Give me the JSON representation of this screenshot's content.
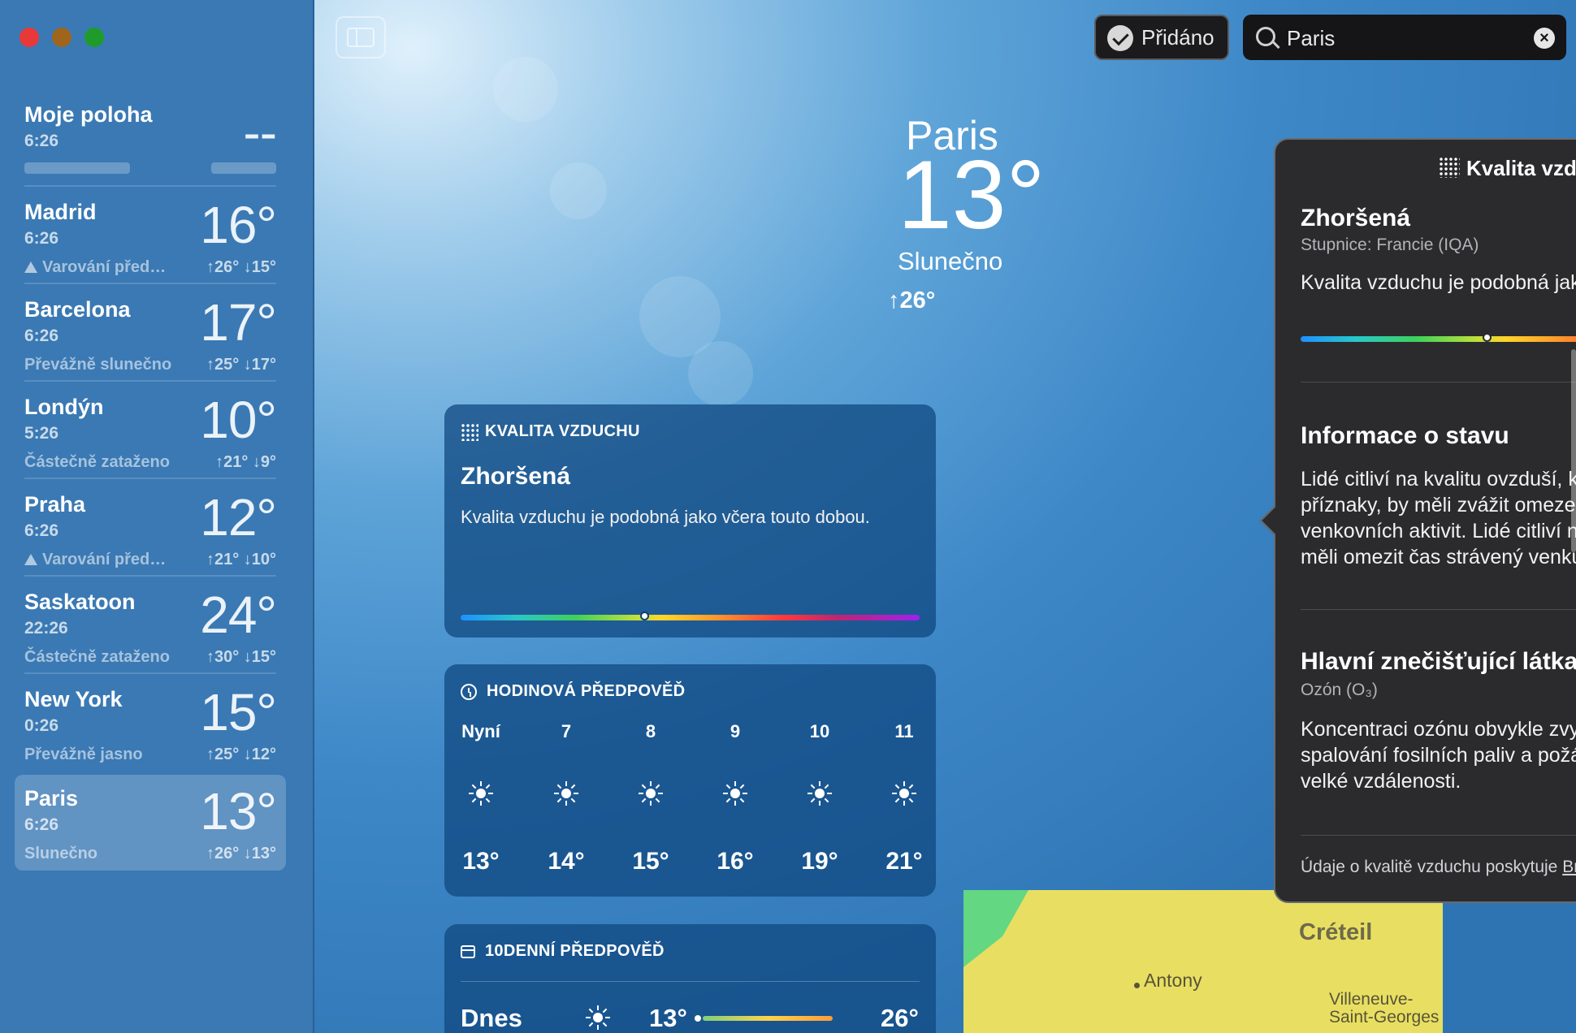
{
  "sidebar": {
    "locations": [
      {
        "name": "Moje poloha",
        "time": "6:26",
        "temp": "--",
        "condition": "",
        "hilo": "",
        "warning": false,
        "selected": false
      },
      {
        "name": "Madrid",
        "time": "6:26",
        "temp": "16°",
        "condition": "Varování před…",
        "hilo": "↑26° ↓15°",
        "warning": true,
        "selected": false
      },
      {
        "name": "Barcelona",
        "time": "6:26",
        "temp": "17°",
        "condition": "Převážně slunečno",
        "hilo": "↑25° ↓17°",
        "warning": false,
        "selected": false
      },
      {
        "name": "Londýn",
        "time": "5:26",
        "temp": "10°",
        "condition": "Částečně zataženo",
        "hilo": "↑21° ↓9°",
        "warning": false,
        "selected": false
      },
      {
        "name": "Praha",
        "time": "6:26",
        "temp": "12°",
        "condition": "Varování před…",
        "hilo": "↑21° ↓10°",
        "warning": true,
        "selected": false
      },
      {
        "name": "Saskatoon",
        "time": "22:26",
        "temp": "24°",
        "condition": "Částečně zataženo",
        "hilo": "↑30° ↓15°",
        "warning": false,
        "selected": false
      },
      {
        "name": "New York",
        "time": "0:26",
        "temp": "15°",
        "condition": "Převážně jasno",
        "hilo": "↑25° ↓12°",
        "warning": false,
        "selected": false
      },
      {
        "name": "Paris",
        "time": "6:26",
        "temp": "13°",
        "condition": "Slunečno",
        "hilo": "↑26° ↓13°",
        "warning": false,
        "selected": true
      }
    ]
  },
  "toolbar": {
    "added_label": "Přidáno",
    "search_value": "Paris",
    "clear_icon": "×"
  },
  "hero": {
    "city": "Paris",
    "temp": "13°",
    "condition": "Slunečno",
    "hilo": "↑26°"
  },
  "air_quality_card": {
    "header": "KVALITA VZDUCHU",
    "status": "Zhoršená",
    "description": "Kvalita vzduchu je podobná jako včera touto dobou.",
    "level_fraction": 0.4
  },
  "hourly_card": {
    "header": "HODINOVÁ PŘEDPOVĚĎ",
    "hours": [
      {
        "hour": "Nyní",
        "temp": "13°",
        "icon": "sun-icon"
      },
      {
        "hour": "7",
        "temp": "14°",
        "icon": "sun-icon"
      },
      {
        "hour": "8",
        "temp": "15°",
        "icon": "sun-icon"
      },
      {
        "hour": "9",
        "temp": "16°",
        "icon": "sun-icon"
      },
      {
        "hour": "10",
        "temp": "19°",
        "icon": "sun-icon"
      },
      {
        "hour": "11",
        "temp": "21°",
        "icon": "sun-icon"
      }
    ]
  },
  "daily_card": {
    "header": "10DENNÍ PŘEDPOVĚĎ",
    "rows": [
      {
        "day": "Dnes",
        "low": "13°",
        "high": "26°",
        "icon": "sun-icon"
      }
    ]
  },
  "map": {
    "labels": [
      "Créteil",
      "Antony",
      "Villeneuve-",
      "Saint-Georges"
    ]
  },
  "popover": {
    "title": "Kvalita vzduchu",
    "status": "Zhoršená",
    "scale": "Stupnice: Francie (IQA)",
    "description": "Kvalita vzduchu je podobná jako včera touto dobou.",
    "level_fraction": 0.4,
    "info_title": "Informace o stavu",
    "info_text": "Lidé citliví na kvalitu ovzduší, kteří zaznamenají příznaky, by měli zvážit omezení namáhavých venkovních aktivit. Lidé citliví na kvalitu ovzduší by měli omezit čas strávený venku.",
    "pollutant_title": "Hlavní znečišťující látka",
    "pollutant_name": "Ozón (O₃)",
    "pollutant_text": "Koncentraci ozónu obvykle zvyšuje doprava, spalování fosilních paliv a požáry. Může se šířit na velké vzdálenosti.",
    "footer_prefix": "Údaje o kvalitě vzduchu poskytuje ",
    "footer_link": "BreezoMeter"
  },
  "colors": {
    "sidebar_bg": "#3a79b4",
    "popover_bg": "#2b2b2d",
    "card_bg": "#104880"
  }
}
